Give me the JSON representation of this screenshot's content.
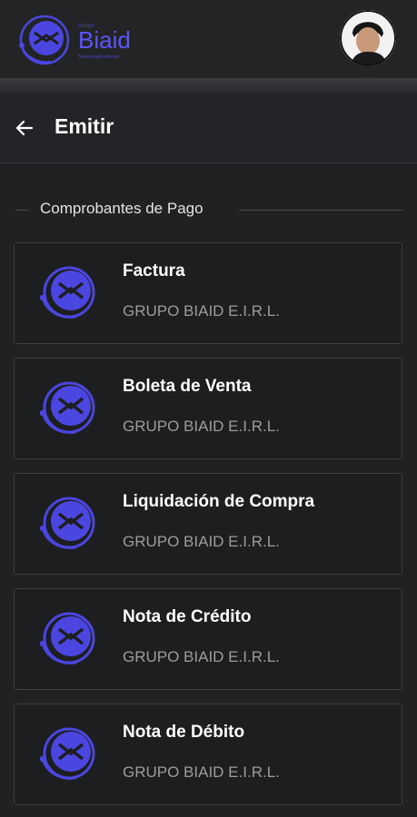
{
  "header": {
    "logo": {
      "small": "Grupo",
      "title": "Biaid",
      "tagline": "Telecomunicaciones"
    },
    "brand_color": "#5b55ff",
    "avatar_alt": "user-avatar"
  },
  "subheader": {
    "title": "Emitir"
  },
  "section": {
    "label": "Comprobantes de Pago"
  },
  "cards": [
    {
      "title": "Factura",
      "subtitle": "GRUPO BIAID E.I.R.L."
    },
    {
      "title": "Boleta de Venta",
      "subtitle": "GRUPO BIAID E.I.R.L."
    },
    {
      "title": "Liquidación de Compra",
      "subtitle": "GRUPO BIAID E.I.R.L."
    },
    {
      "title": "Nota de Crédito",
      "subtitle": "GRUPO BIAID E.I.R.L."
    },
    {
      "title": "Nota de Débito",
      "subtitle": "GRUPO BIAID E.I.R.L."
    }
  ]
}
